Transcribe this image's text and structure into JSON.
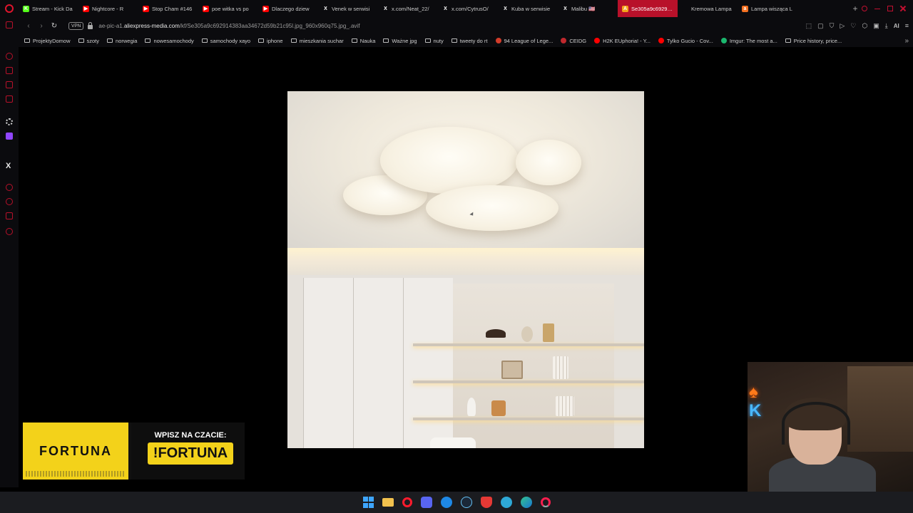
{
  "tabs": [
    {
      "title": "Stream - Kick Da",
      "color": "#53fc18",
      "letter": "K"
    },
    {
      "title": "Nightcore - R",
      "color": "#ff0000",
      "letter": "▶"
    },
    {
      "title": "Stop Cham #146",
      "color": "#ff0000",
      "letter": "▶"
    },
    {
      "title": "poe witka vs po",
      "color": "#ff0000",
      "letter": "▶"
    },
    {
      "title": "Dlaczego dziew",
      "color": "#ff0000",
      "letter": "▶"
    },
    {
      "title": "Venek w serwisi",
      "color": "#0b0b0e",
      "letter": "X"
    },
    {
      "title": "x.com/Neat_22/",
      "color": "#0b0b0e",
      "letter": "X"
    },
    {
      "title": "x.com/CytrusO/",
      "color": "#0b0b0e",
      "letter": "X"
    },
    {
      "title": "Kuba w serwisie",
      "color": "#0b0b0e",
      "letter": "X"
    },
    {
      "title": "Malibu 🇺🇸 ",
      "color": "#0b0b0e",
      "letter": "X"
    },
    {
      "title": "Se305a9c692914383aa34",
      "color": "#f3a21a",
      "letter": "A",
      "active": true
    },
    {
      "title": "Kremowa Lampa",
      "color": "#0b0b0e",
      "letter": ""
    },
    {
      "title": "Lampa wisząca L",
      "color": "#f37021",
      "letter": "a"
    }
  ],
  "address": {
    "vpn_label": "VPN",
    "url_prefix": "ae-pic-a1.",
    "url_domain": "aliexpress-media.com",
    "url_path": "/kf/Se305a9c692914383aa34672d59b21c95l.jpg_960x960q75.jpg_.avif",
    "ai_label": "AI"
  },
  "bookmarks": [
    {
      "label": "ProjektyDomow",
      "kind": "folder"
    },
    {
      "label": "szoty",
      "kind": "folder"
    },
    {
      "label": "norwegia",
      "kind": "folder"
    },
    {
      "label": "nowesamochody",
      "kind": "folder"
    },
    {
      "label": "samochody xayo",
      "kind": "folder"
    },
    {
      "label": "iphone",
      "kind": "folder"
    },
    {
      "label": "mieszkania suchar",
      "kind": "folder"
    },
    {
      "label": "Nauka",
      "kind": "folder"
    },
    {
      "label": "Ważne jpg",
      "kind": "folder"
    },
    {
      "label": "nuty",
      "kind": "folder"
    },
    {
      "label": "tweety do rt",
      "kind": "folder"
    },
    {
      "label": "94 League of Lege...",
      "kind": "site",
      "color": "#d23c2a"
    },
    {
      "label": "CEIDG",
      "kind": "site",
      "color": "#c0282d"
    },
    {
      "label": "H2K EUphoria! - Y...",
      "kind": "site",
      "color": "#ff0000"
    },
    {
      "label": "Tylko Gucio - Cov...",
      "kind": "site",
      "color": "#ff0000"
    },
    {
      "label": "Imgur: The most a...",
      "kind": "site",
      "color": "#1bb76e"
    },
    {
      "label": "Price history, price...",
      "kind": "page"
    }
  ],
  "ad": {
    "brand": "FORTUNA",
    "cta": "WPISZ NA CZACIE:",
    "command": "!FORTUNA"
  },
  "webcam": {
    "neon_text": "K"
  }
}
